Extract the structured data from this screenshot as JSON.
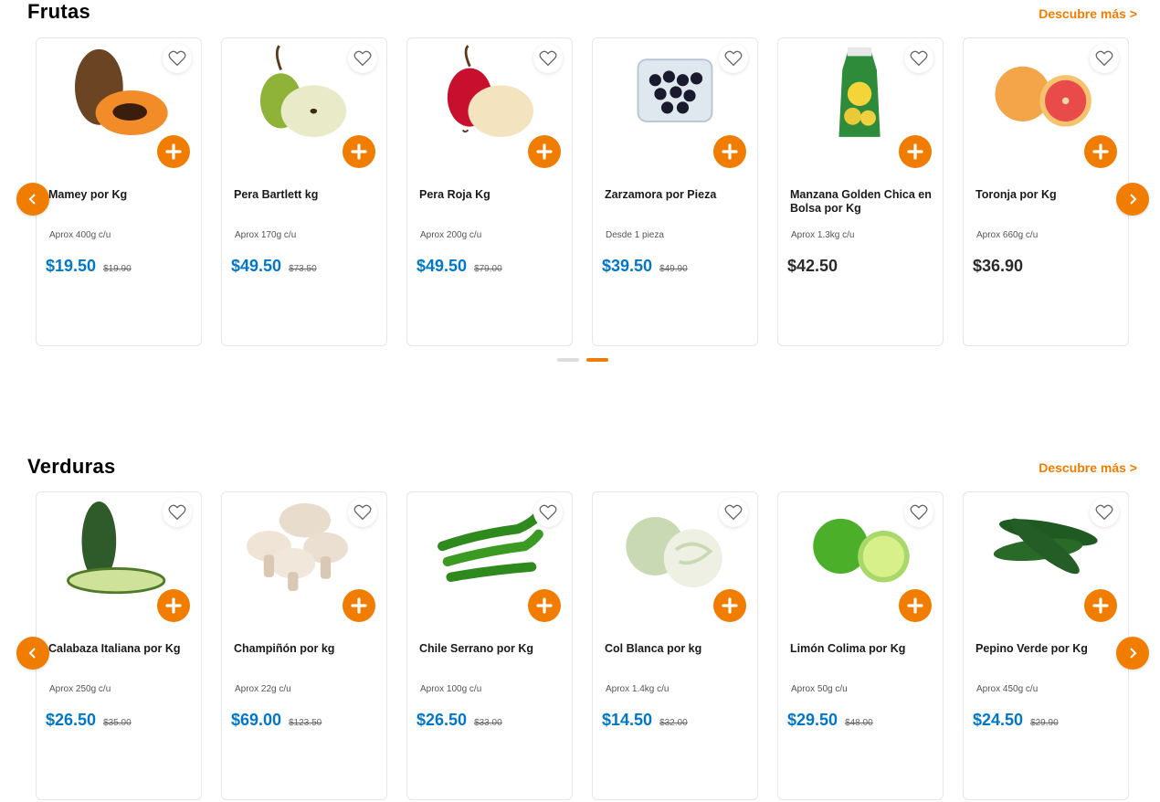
{
  "colors": {
    "accent": "#f07c00",
    "price": "#0077c8"
  },
  "fruits": {
    "title": "Frutas",
    "more": "Descubre más >",
    "items": [
      {
        "name": "Mamey por Kg",
        "note": "Aprox 400g c/u",
        "price": "$19.50",
        "old": "$19.90",
        "image": "mamey"
      },
      {
        "name": "Pera Bartlett kg",
        "note": "Aprox 170g c/u",
        "price": "$49.50",
        "old": "$73.50",
        "image": "pear-green"
      },
      {
        "name": "Pera Roja Kg",
        "note": "Aprox 200g c/u",
        "price": "$49.50",
        "old": "$79.00",
        "image": "pear-red"
      },
      {
        "name": "Zarzamora por Pieza",
        "note": "Desde 1 pieza",
        "price": "$39.50",
        "old": "$49.90",
        "image": "blackberries"
      },
      {
        "name": "Manzana Golden Chica en Bolsa por Kg",
        "note": "Aprox 1.3kg c/u",
        "price": "$42.50",
        "old": "",
        "image": "apple-bag"
      },
      {
        "name": "Toronja por Kg",
        "note": "Aprox 660g c/u",
        "price": "$36.90",
        "old": "",
        "image": "grapefruit"
      }
    ]
  },
  "vegetables": {
    "title": "Verduras",
    "more": "Descubre más >",
    "items": [
      {
        "name": "Calabaza Italiana por Kg",
        "note": "Aprox 250g c/u",
        "price": "$26.50",
        "old": "$35.00",
        "image": "zucchini"
      },
      {
        "name": "Champiñón por kg",
        "note": "Aprox 22g c/u",
        "price": "$69.00",
        "old": "$123.50",
        "image": "mushrooms"
      },
      {
        "name": "Chile Serrano por Kg",
        "note": "Aprox 100g c/u",
        "price": "$26.50",
        "old": "$33.00",
        "image": "chili"
      },
      {
        "name": "Col Blanca por kg",
        "note": "Aprox 1.4kg c/u",
        "price": "$14.50",
        "old": "$32.00",
        "image": "cabbage"
      },
      {
        "name": "Limón Colima por Kg",
        "note": "Aprox 50g c/u",
        "price": "$29.50",
        "old": "$48.00",
        "image": "lime"
      },
      {
        "name": "Pepino Verde por Kg",
        "note": "Aprox 450g c/u",
        "price": "$24.50",
        "old": "$29.90",
        "image": "cucumber"
      }
    ]
  },
  "carousel": {
    "page_count": 2,
    "active_page": 2
  }
}
